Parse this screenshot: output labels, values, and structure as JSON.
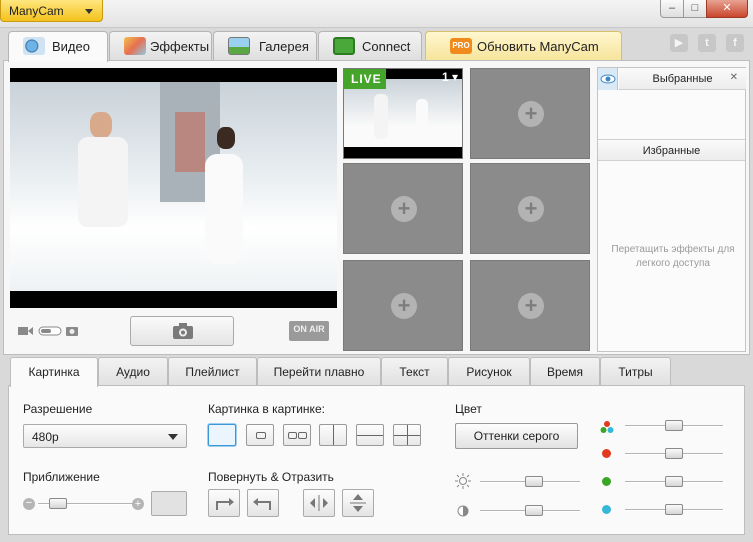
{
  "app": {
    "menu_label": "ManyCam",
    "window_controls": {
      "minimize": "–",
      "maximize": "□",
      "close": "✕"
    }
  },
  "main_tabs": [
    {
      "label": "Видео",
      "icon": "video-sources-icon",
      "active": true
    },
    {
      "label": "Эффекты",
      "icon": "effects-icon",
      "active": false
    },
    {
      "label": "Галерея",
      "icon": "gallery-icon",
      "active": false
    },
    {
      "label": "Connect",
      "icon": "connect-icon",
      "active": false
    },
    {
      "label": "Обновить ManyCam",
      "icon": "pro-icon",
      "badge": "PRO",
      "active": false
    }
  ],
  "social": [
    {
      "icon": "youtube-icon",
      "glyph": "▶"
    },
    {
      "icon": "twitter-icon",
      "glyph": "t"
    },
    {
      "icon": "facebook-icon",
      "glyph": "f"
    }
  ],
  "preview": {
    "onair_label": "ON AIR"
  },
  "sources": {
    "live_label": "LIVE",
    "live_number": "1",
    "add_glyph": "+"
  },
  "favorites": {
    "selected_title": "Выбранные",
    "favorites_title": "Избранные",
    "close_glyph": "✕",
    "hint": "Перетащить эффекты для легкого доступа"
  },
  "settings_tabs": [
    {
      "label": "Картинка",
      "active": true
    },
    {
      "label": "Аудио",
      "active": false
    },
    {
      "label": "Плейлист",
      "active": false
    },
    {
      "label": "Перейти плавно",
      "active": false
    },
    {
      "label": "Текст",
      "active": false
    },
    {
      "label": "Рисунок",
      "active": false
    },
    {
      "label": "Время",
      "active": false
    },
    {
      "label": "Титры",
      "active": false
    }
  ],
  "picture": {
    "resolution_label": "Разрешение",
    "resolution_value": "480p",
    "zoom_label": "Приближение",
    "zoom_minus": "−",
    "zoom_plus": "+",
    "zoom_level": 0.12,
    "pip_label": "Картинка в картинке:",
    "rotate_label": "Повернуть & Отразить",
    "color_label": "Цвет",
    "grayscale_button": "Оттенки серого",
    "sliders": {
      "brightness": 0.55,
      "contrast": 0.55,
      "saturation": 0.5,
      "red": 0.5,
      "green": 0.5,
      "blue": 0.5
    },
    "colors": {
      "red": "#e23a1e",
      "green": "#3aa626",
      "blue": "#35b7d8",
      "accent": "#3d96d6"
    }
  }
}
